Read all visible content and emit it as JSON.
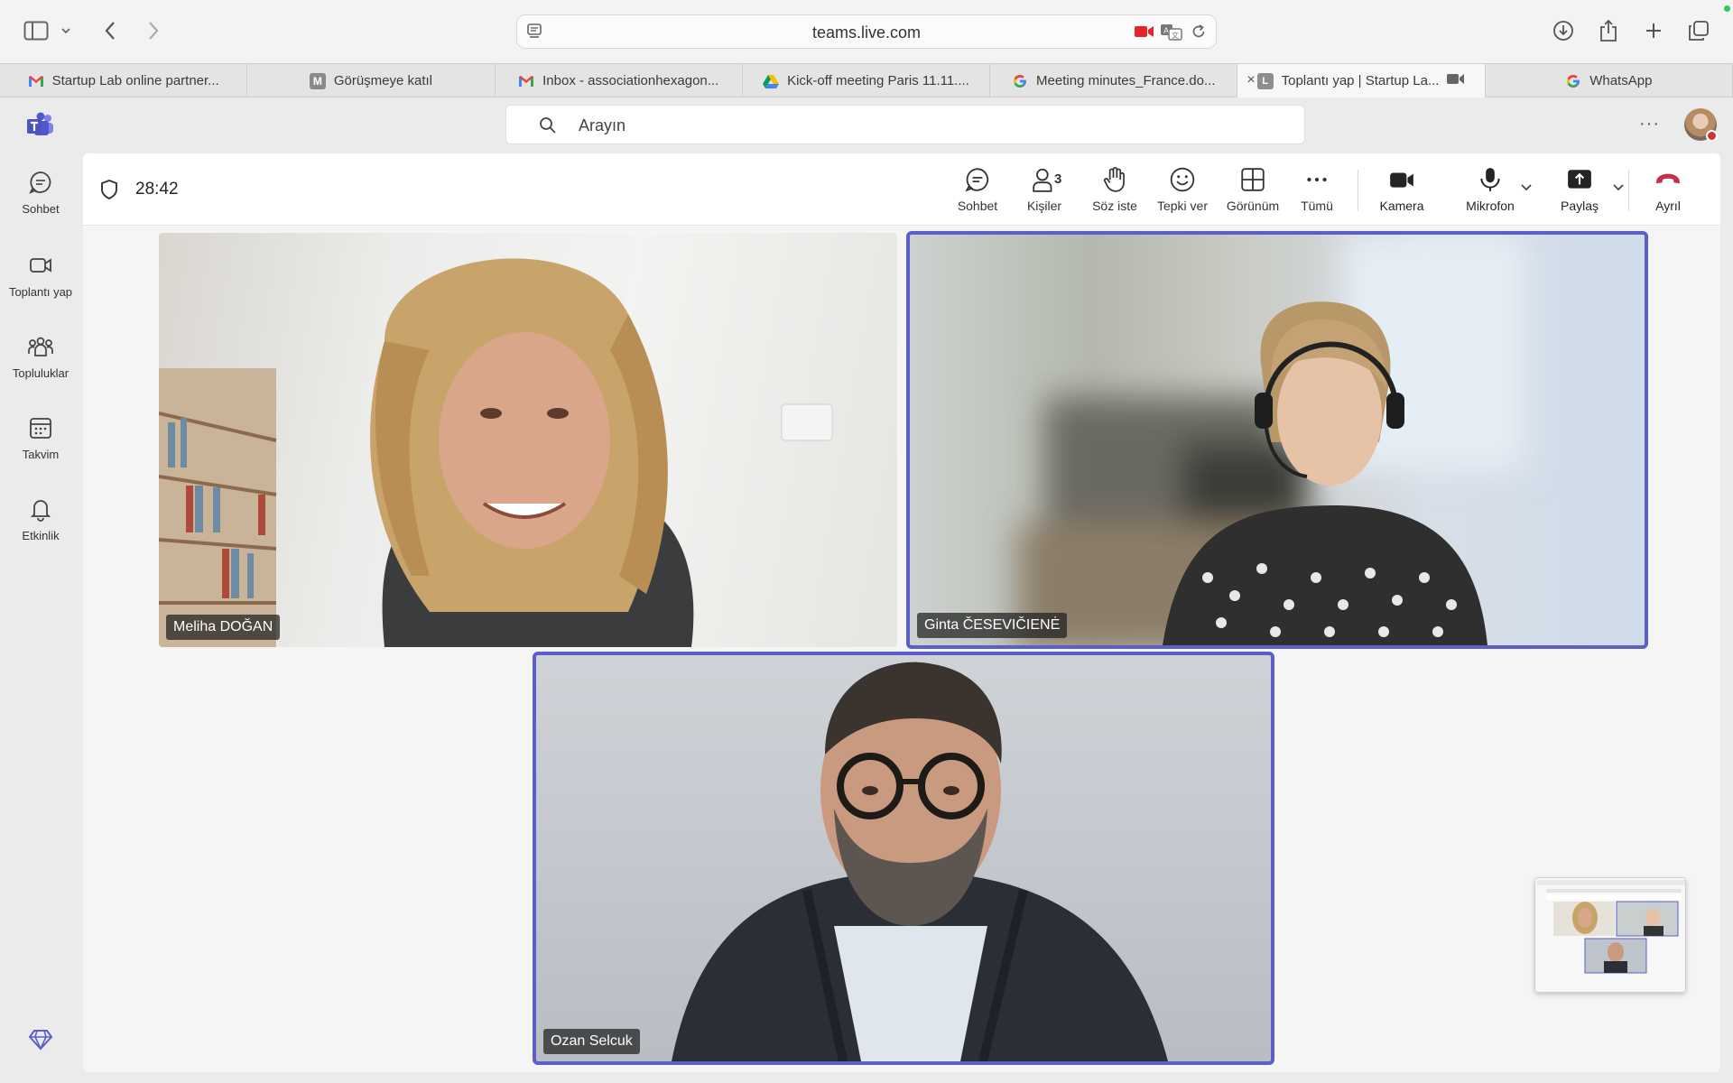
{
  "browser": {
    "url": "teams.live.com",
    "tabs": [
      {
        "label": "Startup Lab online partner...",
        "icon": "gmail-icon"
      },
      {
        "label": "Görüşmeye katıl",
        "icon": "m-icon"
      },
      {
        "label": "Inbox - associationhexagon...",
        "icon": "gmail-icon"
      },
      {
        "label": "Kick-off meeting Paris 11.11....",
        "icon": "google-drive-icon"
      },
      {
        "label": "Meeting minutes_France.do...",
        "icon": "google-icon"
      },
      {
        "label": "Toplantı yap | Startup La...",
        "icon": "l-icon",
        "active": true
      },
      {
        "label": "WhatsApp",
        "icon": "google-icon"
      }
    ],
    "tab_letters": {
      "m": "M",
      "l": "L"
    },
    "close_glyph": "×"
  },
  "teams": {
    "search_placeholder": "Arayın",
    "more_glyph": "···",
    "rail": {
      "chat": "Sohbet",
      "meet": "Toplantı yap",
      "communities": "Topluluklar",
      "calendar": "Takvim",
      "activity": "Etkinlik"
    }
  },
  "meeting": {
    "timer": "28:42",
    "controls": {
      "chat": "Sohbet",
      "people": "Kişiler",
      "people_count": "3",
      "raise_hand": "Söz iste",
      "react": "Tepki ver",
      "view": "Görünüm",
      "more": "Tümü",
      "camera": "Kamera",
      "mic": "Mikrofon",
      "share": "Paylaş",
      "leave": "Ayrıl"
    },
    "participants": [
      {
        "name": "Meliha DOĞAN",
        "speaking": false
      },
      {
        "name": "Ginta ČESEVIČIENĖ",
        "speaking": true
      },
      {
        "name": "Ozan Selcuk",
        "speaking": true
      }
    ]
  },
  "colors": {
    "accent": "#5b5fc7",
    "leave": "#c4314b",
    "record": "#e5252a"
  }
}
